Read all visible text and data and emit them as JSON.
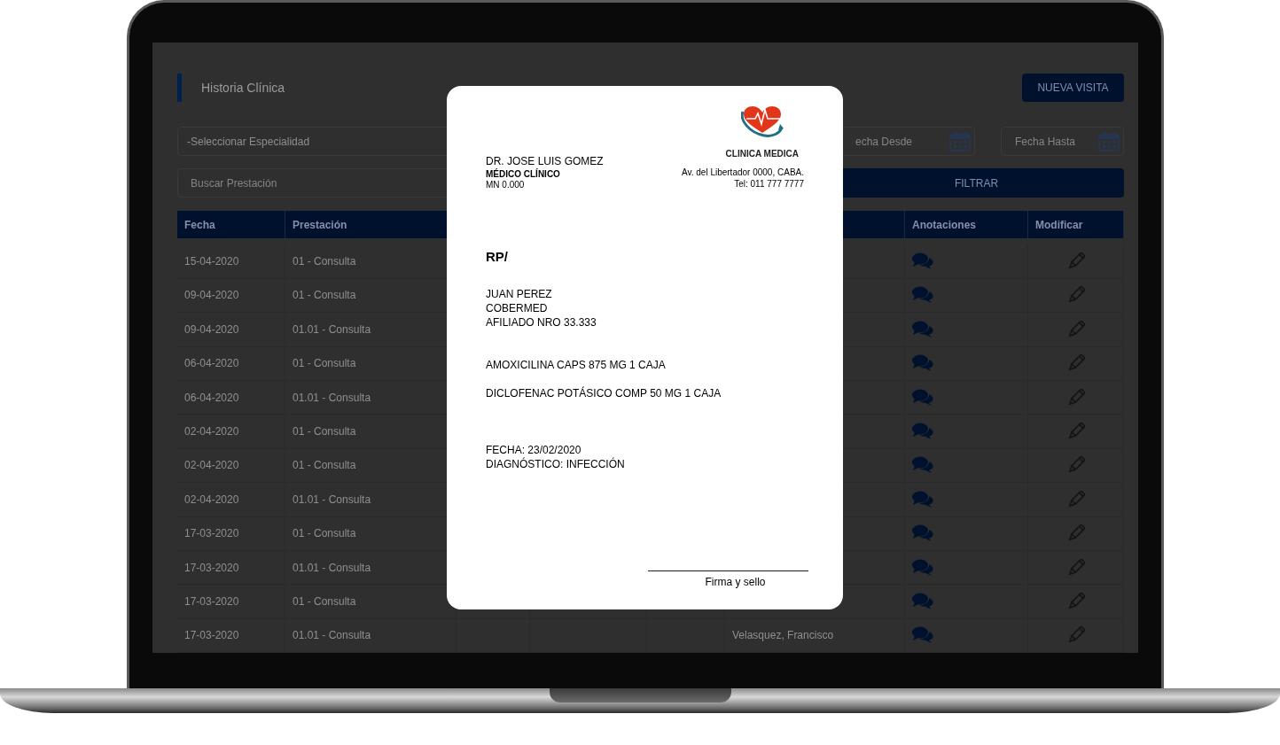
{
  "app": {
    "title": "Historia Clínica",
    "new_visit_button": "NUEVA VISITA",
    "filters": {
      "specialty_select": "-Seleccionar Especialidad",
      "search": {
        "placeholder": "Buscar Prestación"
      },
      "date_from": {
        "placeholder": "echa Desde"
      },
      "date_to": {
        "placeholder": "Fecha Hasta"
      },
      "filter_button": "FILTRAR"
    },
    "table": {
      "columns": {
        "left": [
          "Fecha",
          "Prestación"
        ],
        "right": [
          "Anotaciones",
          "Modificar"
        ]
      },
      "rows": [
        {
          "fecha": "15-04-2020",
          "prestacion": "01 - Consulta"
        },
        {
          "fecha": "09-04-2020",
          "prestacion": "01 - Consulta"
        },
        {
          "fecha": "09-04-2020",
          "prestacion": "01.01 - Consulta"
        },
        {
          "fecha": "06-04-2020",
          "prestacion": "01 - Consulta"
        },
        {
          "fecha": "06-04-2020",
          "prestacion": "01.01 - Consulta"
        },
        {
          "fecha": "02-04-2020",
          "prestacion": "01 - Consulta"
        },
        {
          "fecha": "02-04-2020",
          "prestacion": "01 - Consulta"
        },
        {
          "fecha": "02-04-2020",
          "prestacion": "01.01 - Consulta"
        },
        {
          "fecha": "17-03-2020",
          "prestacion": "01 - Consulta"
        },
        {
          "fecha": "17-03-2020",
          "prestacion": "01.01 - Consulta"
        },
        {
          "fecha": "17-03-2020",
          "prestacion": "01 - Consulta"
        },
        {
          "fecha": "17-03-2020",
          "prestacion": "01.01 - Consulta",
          "column_6": "Velasquez, Francisco"
        }
      ]
    }
  },
  "prescription": {
    "doctor": {
      "name": "DR. JOSE LUIS GOMEZ",
      "specialty": "MÉDICO CLÍNICO",
      "license": "MN 0.000"
    },
    "clinic": {
      "name": "CLINICA MEDICA",
      "address": "Av. del Libertador 0000, CABA.",
      "phone": "Tel: 011 777 7777"
    },
    "rp": "RP/",
    "patient": [
      "JUAN PEREZ",
      "COBERMED",
      "AFILIADO NRO 33.333"
    ],
    "medications": [
      "AMOXICILINA CAPS 875 MG 1 CAJA",
      "DICLOFENAC POTÁSICO COMP 50 MG 1 CAJA"
    ],
    "date": "FECHA: 23/02/2020",
    "diagnosis": "DIAGNÓSTICO: INFECCIÓN",
    "signature_label": "Firma y sello"
  }
}
